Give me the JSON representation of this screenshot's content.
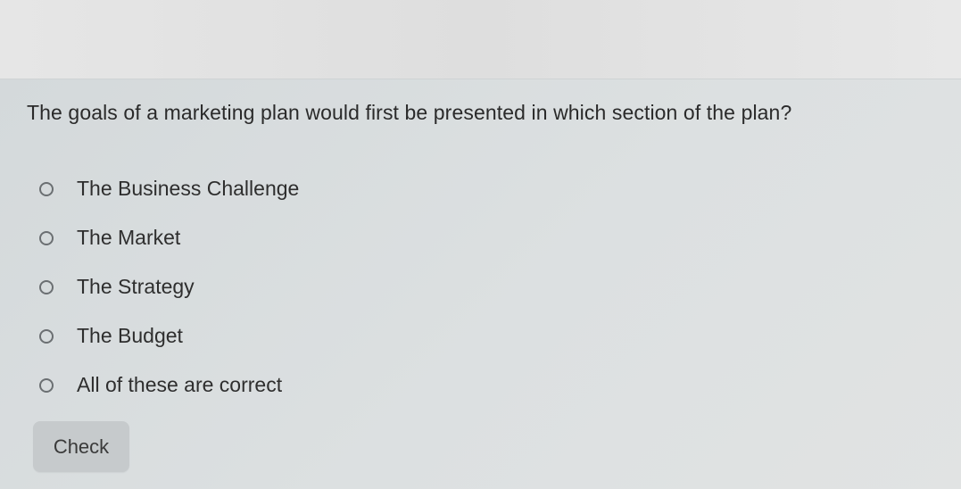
{
  "question": {
    "text": "The goals of a marketing plan would first be presented in which section of the plan?"
  },
  "options": [
    {
      "label": "The Business Challenge",
      "selected": false
    },
    {
      "label": "The Market",
      "selected": false
    },
    {
      "label": "The Strategy",
      "selected": false
    },
    {
      "label": "The Budget",
      "selected": false
    },
    {
      "label": "All of these are correct",
      "selected": false
    }
  ],
  "actions": {
    "check_label": "Check"
  },
  "colors": {
    "card_background": "#d8dcde",
    "button_background": "#c6cacc",
    "text": "#2a2a2a",
    "radio_border": "#6b6f72"
  },
  "icons": {
    "option_icon": "radio-unselected-icon"
  }
}
